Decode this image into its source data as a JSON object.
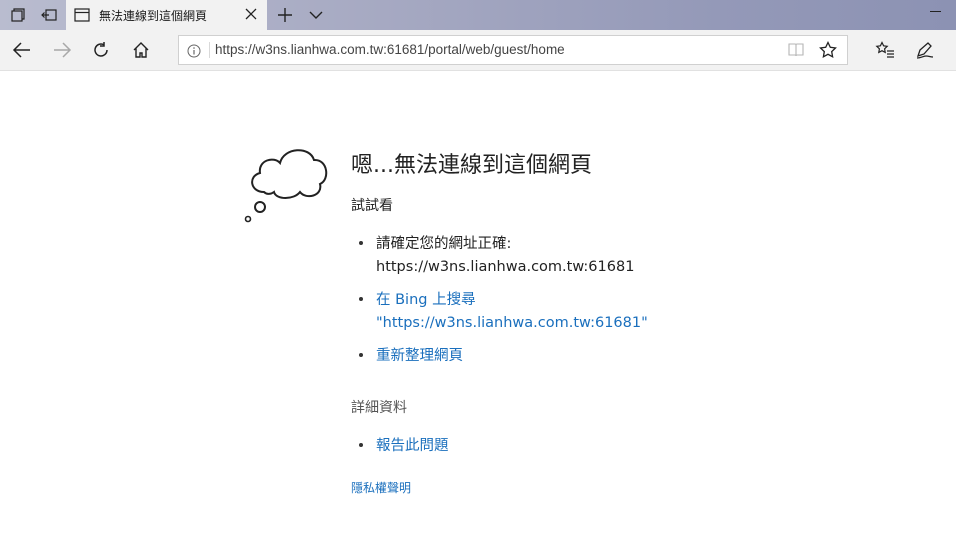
{
  "tab": {
    "title": "無法連線到這個網頁"
  },
  "address": {
    "url": "https://w3ns.lianhwa.com.tw:61681/portal/web/guest/home"
  },
  "error": {
    "title": "嗯...無法連線到這個網頁",
    "try_label": "試試看",
    "check_line1": "請確定您的網址正確:",
    "check_line2": "https://w3ns.lianhwa.com.tw:61681",
    "bing_line1": "在 Bing 上搜尋",
    "bing_line2": "\"https://w3ns.lianhwa.com.tw:61681\"",
    "refresh": "重新整理網頁",
    "details_label": "詳細資料",
    "report": "報告此問題",
    "privacy": "隱私權聲明"
  },
  "icons": {
    "tab_aside": "set-aside-tabs-icon",
    "restore_tabs": "restore-tabs-icon",
    "page": "page-icon",
    "close": "close-icon",
    "new_tab": "plus-icon",
    "tab_preview": "chevron-down-icon",
    "back": "back-arrow-icon",
    "forward": "forward-arrow-icon",
    "refresh": "refresh-icon",
    "home": "home-icon",
    "info": "info-icon",
    "reading_view": "reading-view-icon",
    "favorite": "star-icon",
    "favorites_hub": "hub-icon",
    "web_note": "pen-icon",
    "cloud": "thought-cloud-icon"
  },
  "colors": {
    "link": "#1a6fbd",
    "titlebar": "#a6a9c2"
  }
}
